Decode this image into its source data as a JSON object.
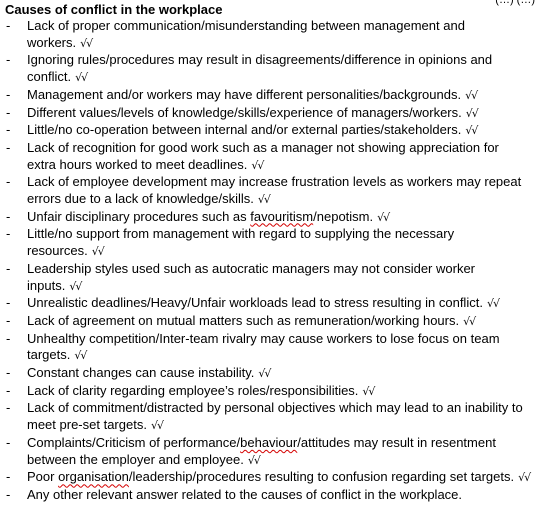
{
  "heading": "Causes of conflict in the workplace",
  "corner_mark": "(…) (…)",
  "tick_mark": "√√",
  "bullet": "-",
  "items": [
    {
      "parts": [
        {
          "t": "Lack of proper communication/misunderstanding between management and workers."
        }
      ],
      "ticks": true
    },
    {
      "parts": [
        {
          "t": "Ignoring rules/procedures may result in disagreements/difference in opinions and conflict."
        }
      ],
      "ticks": true
    },
    {
      "parts": [
        {
          "t": "Management and/or workers may have different personalities/backgrounds."
        }
      ],
      "ticks": true
    },
    {
      "parts": [
        {
          "t": "Different values/levels of knowledge/skills/experience of managers/workers."
        }
      ],
      "ticks": true
    },
    {
      "parts": [
        {
          "t": "Little/no co-operation between internal and/or external parties/stakeholders."
        }
      ],
      "ticks": true
    },
    {
      "parts": [
        {
          "t": "Lack of recognition for good work such as a manager not showing appreciation for extra hours worked to meet deadlines."
        }
      ],
      "ticks": true
    },
    {
      "parts": [
        {
          "t": "Lack of employee development may increase frustration levels as workers may repeat errors due to a lack of knowledge/skills."
        }
      ],
      "ticks": true
    },
    {
      "parts": [
        {
          "t": "Unfair disciplinary procedures such as "
        },
        {
          "t": "favouritism",
          "sq": true
        },
        {
          "t": "/nepotism."
        }
      ],
      "ticks": true
    },
    {
      "parts": [
        {
          "t": "Little/no support from management with regard to supplying the necessary resources."
        }
      ],
      "ticks": true
    },
    {
      "parts": [
        {
          "t": "Leadership styles used such as autocratic managers may not consider worker inputs."
        }
      ],
      "ticks": true
    },
    {
      "parts": [
        {
          "t": "Unrealistic deadlines/Heavy/Unfair workloads lead to stress resulting in conflict."
        }
      ],
      "ticks": true
    },
    {
      "parts": [
        {
          "t": "Lack of agreement on mutual matters such as remuneration/working hours."
        }
      ],
      "ticks": true
    },
    {
      "parts": [
        {
          "t": "Unhealthy competition/Inter-team rivalry may cause workers to lose focus on team targets."
        }
      ],
      "ticks": true
    },
    {
      "parts": [
        {
          "t": "Constant changes can cause instability."
        }
      ],
      "ticks": true
    },
    {
      "parts": [
        {
          "t": "Lack of clarity regarding employee’s roles/responsibilities."
        }
      ],
      "ticks": true
    },
    {
      "parts": [
        {
          "t": "Lack of commitment/distracted by personal objectives which may lead to an inability to meet pre-set targets."
        }
      ],
      "ticks": true
    },
    {
      "parts": [
        {
          "t": "Complaints/Criticism of performance/"
        },
        {
          "t": "behaviour",
          "sq": true
        },
        {
          "t": "/attitudes may result in resentment between the employer and employee."
        }
      ],
      "ticks": true
    },
    {
      "parts": [
        {
          "t": "Poor "
        },
        {
          "t": "organisation",
          "sq": true
        },
        {
          "t": "/leadership/procedures resulting to confusion regarding set targets."
        }
      ],
      "ticks": true
    },
    {
      "parts": [
        {
          "t": "Any other relevant answer related to the causes of conflict in the workplace."
        }
      ],
      "ticks": false
    }
  ]
}
